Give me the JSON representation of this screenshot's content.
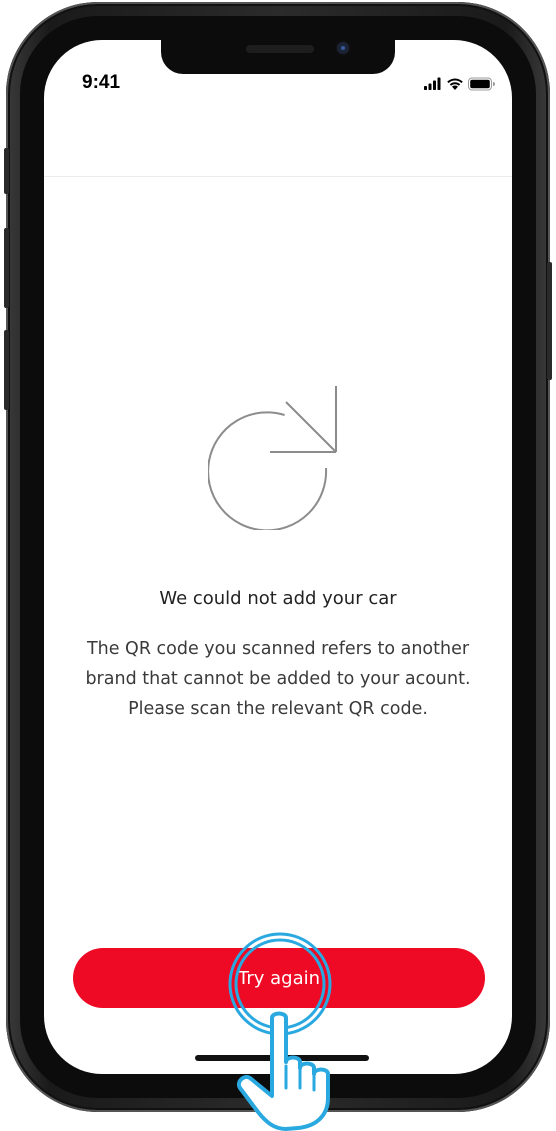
{
  "status_bar": {
    "time": "9:41",
    "signal_icon": "cellular-signal-icon",
    "wifi_icon": "wifi-icon",
    "battery_icon": "battery-icon"
  },
  "main": {
    "icon": "refresh-icon",
    "title": "We could not add your car",
    "message": "The QR code you scanned refers to another brand that cannot be added to your acount. Please scan the relevant QR code.",
    "button_label": "Try again"
  },
  "overlay": {
    "tap_indicator_icon": "tap-ripple-icon",
    "hand_icon": "hand-pointer-icon"
  },
  "colors": {
    "accent": "#ee0a24",
    "ripple": "#2aa8e0",
    "text_primary": "#222222",
    "text_secondary": "#3a3a3a"
  }
}
